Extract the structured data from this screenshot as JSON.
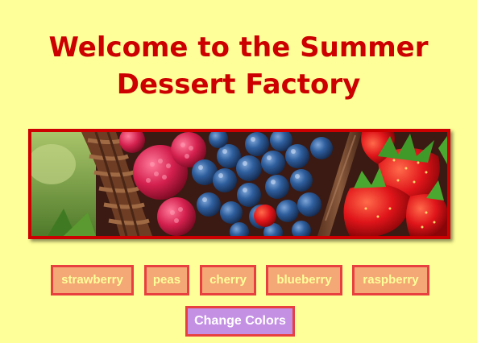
{
  "page": {
    "title": "Welcome to the Summer Dessert Factory",
    "background_color": "#ffff99",
    "title_color": "#cc0000"
  },
  "banner": {
    "image_name": "berries-basket-photo",
    "border_color": "#cc0000"
  },
  "fruit_buttons": [
    {
      "label": "strawberry"
    },
    {
      "label": "peas"
    },
    {
      "label": "cherry"
    },
    {
      "label": "blueberry"
    },
    {
      "label": "raspberry"
    }
  ],
  "fruit_button_style": {
    "background": "#f4a875",
    "border": "#e84040",
    "text": "#ffff99"
  },
  "change_colors": {
    "label": "Change Colors",
    "background": "#c490e4",
    "border": "#e84040",
    "text": "#ffffff"
  }
}
